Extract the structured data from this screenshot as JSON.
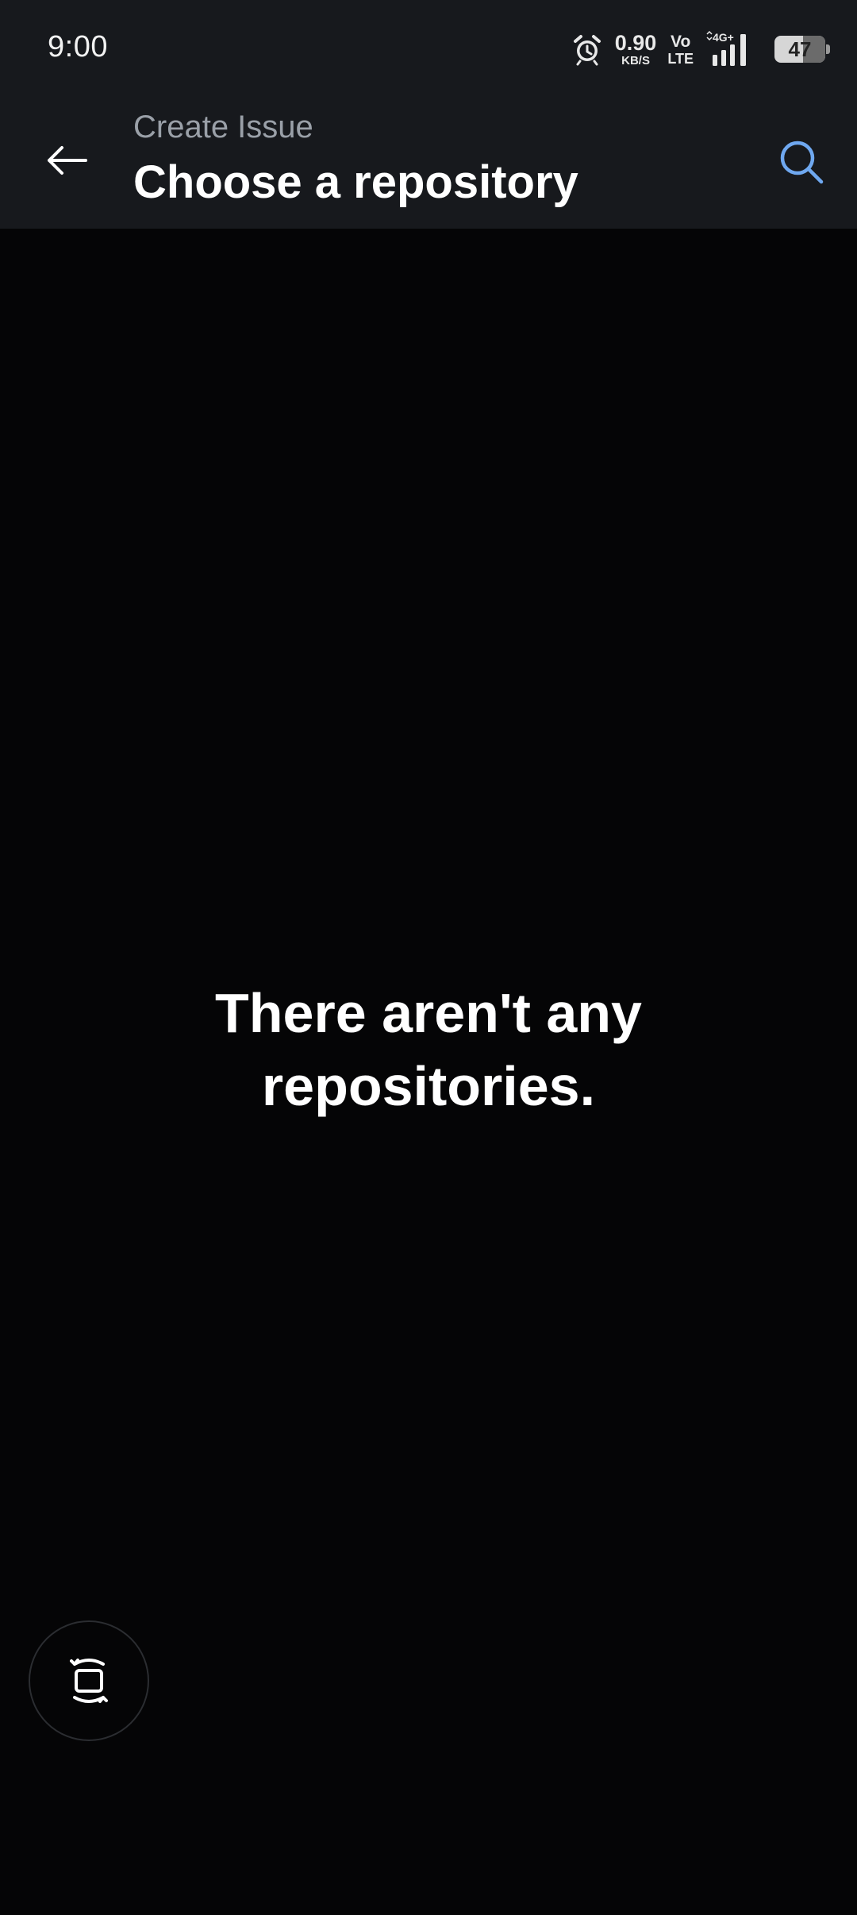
{
  "status_bar": {
    "time": "9:00",
    "net_speed_value": "0.90",
    "net_speed_unit": "KB/S",
    "volte_top": "Vo",
    "volte_bottom": "LTE",
    "network_type": "4G+",
    "battery_level": "47"
  },
  "app_bar": {
    "subtitle": "Create Issue",
    "title": "Choose a repository",
    "back_icon": "arrow-left-icon",
    "search_icon": "search-icon"
  },
  "main": {
    "empty_line_1": "There aren't any",
    "empty_line_2": "repositories."
  },
  "fab": {
    "icon": "rotate-screen-icon"
  },
  "colors": {
    "header_bg": "#17191d",
    "page_bg": "#050506",
    "accent_search": "#6fa8f0",
    "subtitle_text": "#9aa0a8"
  }
}
